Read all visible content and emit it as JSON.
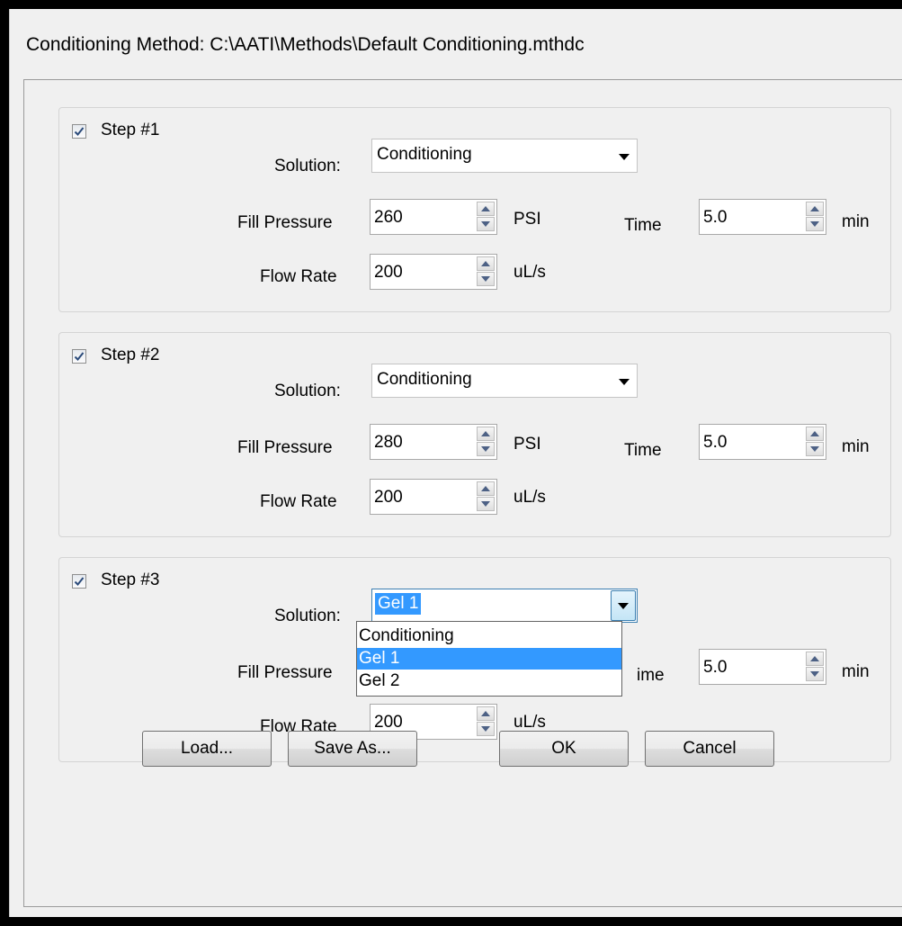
{
  "window": {
    "title": "Conditioning Method: C:\\AATI\\Methods\\Default Conditioning.mthdc"
  },
  "steps": [
    {
      "label": "Step #1",
      "checked": true,
      "solution_label": "Solution:",
      "solution": "Conditioning",
      "fill_pressure_label": "Fill Pressure",
      "fill_pressure": "260",
      "fill_pressure_unit": "PSI",
      "time_label": "Time",
      "time": "5.0",
      "time_unit": "min",
      "flow_rate_label": "Flow Rate",
      "flow_rate": "200",
      "flow_rate_unit": "uL/s"
    },
    {
      "label": "Step #2",
      "checked": true,
      "solution_label": "Solution:",
      "solution": "Conditioning",
      "fill_pressure_label": "Fill Pressure",
      "fill_pressure": "280",
      "fill_pressure_unit": "PSI",
      "time_label": "Time",
      "time": "5.0",
      "time_unit": "min",
      "flow_rate_label": "Flow Rate",
      "flow_rate": "200",
      "flow_rate_unit": "uL/s"
    },
    {
      "label": "Step #3",
      "checked": true,
      "solution_label": "Solution:",
      "solution": "Gel 1",
      "fill_pressure_label": "Fill Pressure",
      "time_label_partial": "ime",
      "time": "5.0",
      "time_unit": "min",
      "flow_rate_label": "Flow Rate",
      "flow_rate": "200",
      "flow_rate_unit": "uL/s"
    }
  ],
  "dropdown": {
    "options": [
      "Conditioning",
      "Gel 1",
      "Gel 2"
    ],
    "selected": "Gel 1"
  },
  "buttons": {
    "load": "Load...",
    "save_as": "Save As...",
    "ok": "OK",
    "cancel": "Cancel"
  },
  "colors": {
    "selection": "#3399ff",
    "window_bg": "#f0f0f0",
    "check": "#2a4a7a"
  }
}
